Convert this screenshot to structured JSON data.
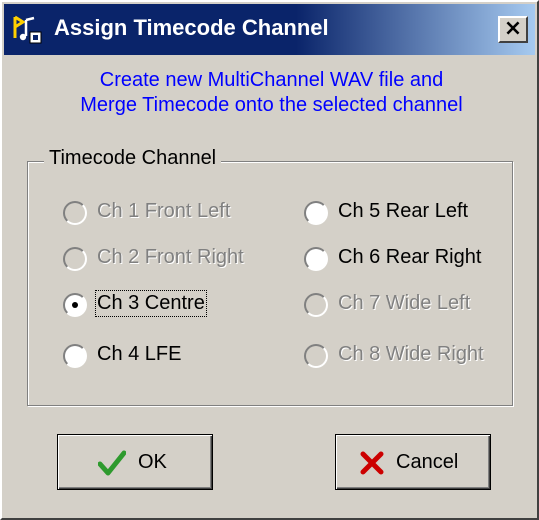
{
  "window": {
    "title": "Assign Timecode Channel",
    "close_glyph": "×",
    "icon": "timecode-app-icon"
  },
  "instructions": {
    "line1": "Create new MultiChannel WAV file and",
    "line2": "Merge Timecode onto the selected channel"
  },
  "group": {
    "label": "Timecode Channel",
    "channels": [
      {
        "label": "Ch 1 Front Left",
        "enabled": false,
        "selected": false
      },
      {
        "label": "Ch 2 Front Right",
        "enabled": false,
        "selected": false
      },
      {
        "label": "Ch 3 Centre",
        "enabled": true,
        "selected": true
      },
      {
        "label": "Ch 4 LFE",
        "enabled": true,
        "selected": false
      },
      {
        "label": "Ch 5 Rear Left",
        "enabled": true,
        "selected": false
      },
      {
        "label": "Ch 6 Rear Right",
        "enabled": true,
        "selected": false
      },
      {
        "label": "Ch 7 Wide Left",
        "enabled": false,
        "selected": false
      },
      {
        "label": "Ch 8 Wide Right",
        "enabled": false,
        "selected": false
      }
    ]
  },
  "buttons": {
    "ok": {
      "label": "OK",
      "icon": "checkmark-icon"
    },
    "cancel": {
      "label": "Cancel",
      "icon": "x-mark-icon"
    }
  },
  "colors": {
    "title_bar": "#0a246a",
    "dialog_face": "#d4d0c8",
    "instruction_text": "#0000ff",
    "ok_check": "#2e9a2e",
    "cancel_x": "#cc0000"
  }
}
